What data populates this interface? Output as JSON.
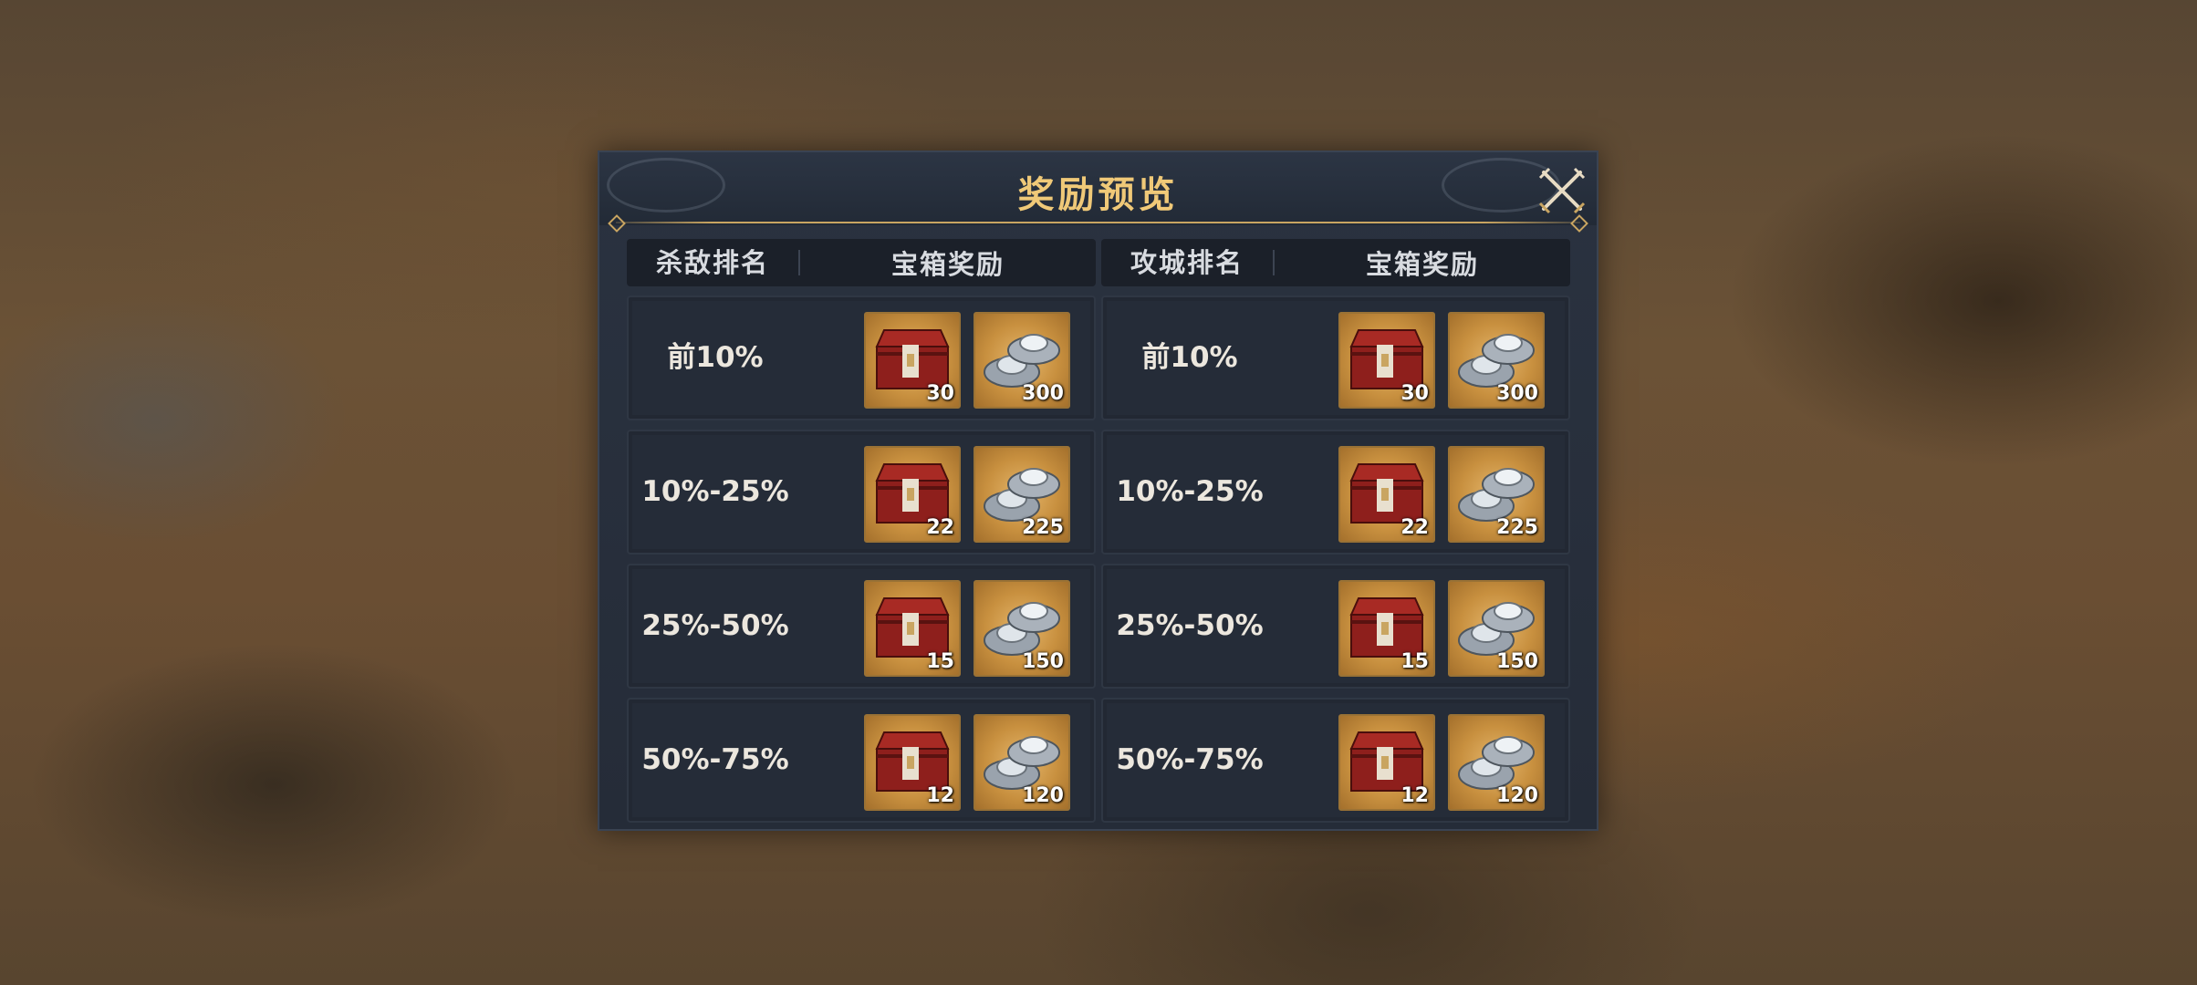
{
  "dialog": {
    "title": "奖励预览"
  },
  "kill_section": {
    "rank_header": "杀敌排名",
    "reward_header": "宝箱奖励",
    "rows": [
      {
        "rank": "前10%",
        "chest_count": "30",
        "silver_count": "300"
      },
      {
        "rank": "10%-25%",
        "chest_count": "22",
        "silver_count": "225"
      },
      {
        "rank": "25%-50%",
        "chest_count": "15",
        "silver_count": "150"
      },
      {
        "rank": "50%-75%",
        "chest_count": "12",
        "silver_count": "120"
      }
    ]
  },
  "siege_section": {
    "rank_header": "攻城排名",
    "reward_header": "宝箱奖励",
    "rows": [
      {
        "rank": "前10%",
        "chest_count": "30",
        "silver_count": "300"
      },
      {
        "rank": "10%-25%",
        "chest_count": "22",
        "silver_count": "225"
      },
      {
        "rank": "25%-50%",
        "chest_count": "15",
        "silver_count": "150"
      },
      {
        "rank": "50%-75%",
        "chest_count": "12",
        "silver_count": "120"
      }
    ]
  },
  "icons": {
    "close": "close-icon",
    "chest": "treasure-chest-icon",
    "silver": "silver-ingot-icon"
  },
  "colors": {
    "title": "#f0c978",
    "panel": "#252c38",
    "item_bg": "#c8903f"
  }
}
